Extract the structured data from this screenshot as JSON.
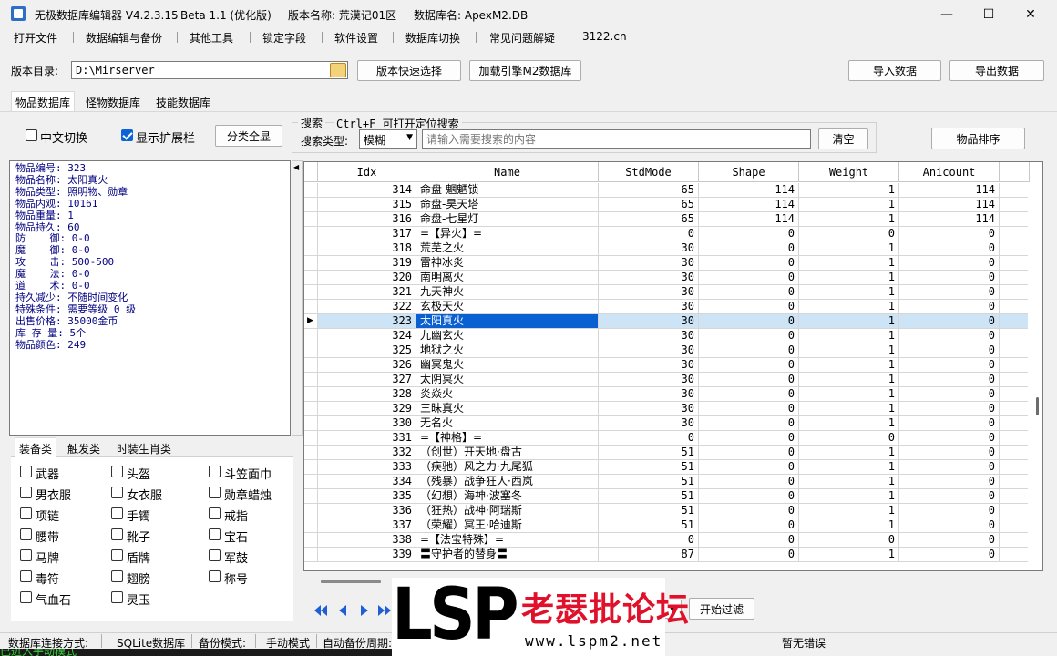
{
  "window": {
    "title": "无极数据库编辑器 V4.2.3.15",
    "beta": "Beta 1.1 (优化版)",
    "version_name": "版本名称: 荒漠记01区",
    "db_name": "数据库名: ApexM2.DB",
    "controls": {
      "minimize": "—",
      "maximize": "☐",
      "close": "✕"
    }
  },
  "menu": [
    "打开文件",
    "数据编辑与备份",
    "其他工具",
    "锁定字段",
    "软件设置",
    "数据库切换",
    "常见问题解疑",
    "3122.cn"
  ],
  "path_row": {
    "label": "版本目录:",
    "value": "D:\\Mirserver",
    "quick_select": "版本快速选择",
    "load_db": "加载引擎M2数据库",
    "import": "导入数据",
    "export": "导出数据"
  },
  "tabs": [
    "物品数据库",
    "怪物数据库",
    "技能数据库"
  ],
  "options": {
    "chinese_toggle": "中文切换",
    "show_ext": "显示扩展栏",
    "show_all": "分类全显",
    "sort": "物品排序",
    "clear": "清空"
  },
  "search": {
    "group_title": "搜索",
    "hint": "Ctrl+F 可打开定位搜索",
    "type_label": "搜索类型:",
    "type_value": "模糊",
    "placeholder": "请输入需要搜索的内容"
  },
  "item_info": [
    "物品编号: 323",
    "物品名称: 太阳真火",
    "物品类型: 照明物、勋章",
    "物品内观: 10161",
    "物品重量: 1",
    "物品持久: 60",
    "防    御: 0-0",
    "魔    御: 0-0",
    "攻    击: 500-500",
    "魔    法: 0-0",
    "道    术: 0-0",
    "持久减少: 不随时间变化",
    "特殊条件: 需要等级 0 级",
    "出售价格: 35000金币",
    "库 存 量: 5个",
    "物品颜色: 249"
  ],
  "category_tabs": [
    "装备类",
    "触发类",
    "时装生肖类"
  ],
  "categories": [
    [
      "武器",
      "头盔",
      "斗笠面巾"
    ],
    [
      "男衣服",
      "女衣服",
      "勋章蜡烛"
    ],
    [
      "项链",
      "手镯",
      "戒指"
    ],
    [
      "腰带",
      "靴子",
      "宝石"
    ],
    [
      "马牌",
      "盾牌",
      "军鼓"
    ],
    [
      "毒符",
      "翅膀",
      "称号"
    ],
    [
      "气血石",
      "灵玉",
      ""
    ]
  ],
  "grid": {
    "columns": [
      "Idx",
      "Name",
      "StdMode",
      "Shape",
      "Weight",
      "Anicount"
    ],
    "selected_idx": "323",
    "rows": [
      [
        "314",
        "命盘-魍魉锁",
        "65",
        "114",
        "1",
        "114"
      ],
      [
        "315",
        "命盘-昊天塔",
        "65",
        "114",
        "1",
        "114"
      ],
      [
        "316",
        "命盘-七星灯",
        "65",
        "114",
        "1",
        "114"
      ],
      [
        "317",
        "=【异火】=",
        "0",
        "0",
        "0",
        "0"
      ],
      [
        "318",
        "荒芜之火",
        "30",
        "0",
        "1",
        "0"
      ],
      [
        "319",
        "雷神冰炎",
        "30",
        "0",
        "1",
        "0"
      ],
      [
        "320",
        "南明离火",
        "30",
        "0",
        "1",
        "0"
      ],
      [
        "321",
        "九天神火",
        "30",
        "0",
        "1",
        "0"
      ],
      [
        "322",
        "玄极天火",
        "30",
        "0",
        "1",
        "0"
      ],
      [
        "323",
        "太阳真火",
        "30",
        "0",
        "1",
        "0"
      ],
      [
        "324",
        "九幽玄火",
        "30",
        "0",
        "1",
        "0"
      ],
      [
        "325",
        "地狱之火",
        "30",
        "0",
        "1",
        "0"
      ],
      [
        "326",
        "幽冥鬼火",
        "30",
        "0",
        "1",
        "0"
      ],
      [
        "327",
        "太阴冥火",
        "30",
        "0",
        "1",
        "0"
      ],
      [
        "328",
        "炎焱火",
        "30",
        "0",
        "1",
        "0"
      ],
      [
        "329",
        "三昧真火",
        "30",
        "0",
        "1",
        "0"
      ],
      [
        "330",
        "无名火",
        "30",
        "0",
        "1",
        "0"
      ],
      [
        "331",
        "=【神格】=",
        "0",
        "0",
        "0",
        "0"
      ],
      [
        "332",
        "（创世）开天地·盘古",
        "51",
        "0",
        "1",
        "0"
      ],
      [
        "333",
        "（疾驰）风之力·九尾狐",
        "51",
        "0",
        "1",
        "0"
      ],
      [
        "334",
        "（残暴）战争狂人·西岚",
        "51",
        "0",
        "1",
        "0"
      ],
      [
        "335",
        "（幻想）海神·波塞冬",
        "51",
        "0",
        "1",
        "0"
      ],
      [
        "336",
        "（狂热）战神·阿瑞斯",
        "51",
        "0",
        "1",
        "0"
      ],
      [
        "337",
        "（荣耀）冥王·哈迪斯",
        "51",
        "0",
        "1",
        "0"
      ],
      [
        "338",
        "=【法宝特殊】=",
        "0",
        "0",
        "0",
        "0"
      ],
      [
        "339",
        "〓守护者的替身〓",
        "87",
        "0",
        "1",
        "0"
      ]
    ]
  },
  "filter_button": "开始过滤",
  "status": {
    "conn_label": "数据库连接方式:",
    "conn_value": "SQLite数据库",
    "backup_label": "备份模式:",
    "backup_value": "手动模式",
    "auto_label": "自动备份周期:",
    "error": "暂无错误",
    "bottom_text": "已进入手动模式"
  },
  "watermark": {
    "logo": "LSP",
    "cn": "老瑟批论坛",
    "url": "www.lspm2.net"
  },
  "colors": {
    "selection": "#0a5fd1",
    "info_text": "#000080",
    "watermark_red": "#e0112b",
    "nav_arrow": "#1f5fd6"
  }
}
